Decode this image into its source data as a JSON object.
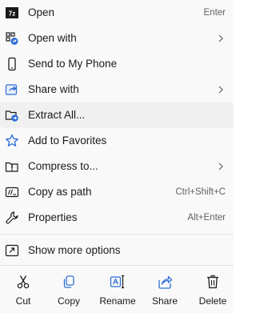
{
  "menu": {
    "items": [
      {
        "label": "Open",
        "shortcut": "Enter",
        "icon": "7zip-icon"
      },
      {
        "label": "Open with",
        "icon": "open-with-icon",
        "submenu": true
      },
      {
        "label": "Send to My Phone",
        "icon": "phone-icon"
      },
      {
        "label": "Share with",
        "icon": "share-with-icon",
        "submenu": true
      },
      {
        "label": "Extract All...",
        "icon": "extract-folder-icon"
      },
      {
        "label": "Add to Favorites",
        "icon": "star-icon"
      },
      {
        "label": "Compress to...",
        "icon": "compress-icon",
        "submenu": true
      },
      {
        "label": "Copy as path",
        "shortcut": "Ctrl+Shift+C",
        "icon": "copy-path-icon"
      },
      {
        "label": "Properties",
        "shortcut": "Alt+Enter",
        "icon": "wrench-icon"
      },
      {
        "label": "Show more options",
        "icon": "show-more-icon"
      }
    ],
    "actions": [
      {
        "label": "Cut",
        "icon": "scissors-icon"
      },
      {
        "label": "Copy",
        "icon": "copy-icon"
      },
      {
        "label": "Rename",
        "icon": "rename-icon"
      },
      {
        "label": "Share",
        "icon": "share-icon"
      },
      {
        "label": "Delete",
        "icon": "trash-icon"
      }
    ]
  },
  "colors": {
    "accent": "#2f6fd6",
    "text": "#1a1a1a",
    "shortcut": "#616161",
    "divider": "#e3e3e3",
    "hover": "#f0f0f0"
  }
}
